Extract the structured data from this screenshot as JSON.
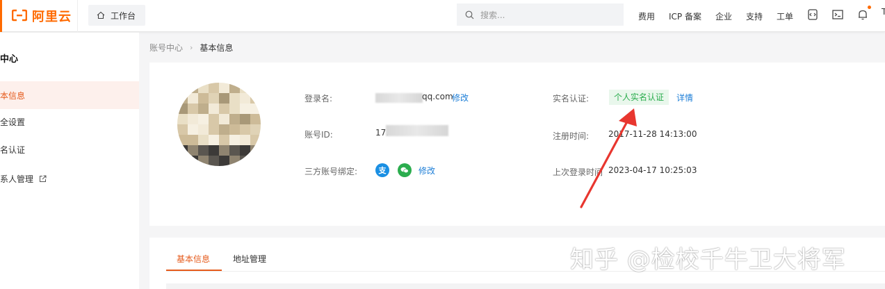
{
  "topbar": {
    "logo_text": "阿里云",
    "workbench_label": "工作台",
    "search_placeholder": "搜索...",
    "nav": [
      "费用",
      "ICP 备案",
      "企业",
      "支持",
      "工单"
    ],
    "truncated_char": "T"
  },
  "sidebar": {
    "title": "中心",
    "items": [
      {
        "label": "本信息",
        "active": true
      },
      {
        "label": "全设置",
        "active": false
      },
      {
        "label": "名认证",
        "active": false
      },
      {
        "label": "系人管理",
        "active": false
      }
    ]
  },
  "breadcrumb": {
    "parent": "账号中心",
    "separator": "›",
    "current": "基本信息"
  },
  "profile": {
    "login_label": "登录名:",
    "login_value_suffix": "qq.com",
    "login_edit": "修改",
    "account_id_label": "账号ID:",
    "account_id_prefix": "17.",
    "third_party_label": "三方账号绑定:",
    "third_party_edit": "修改",
    "realname_label": "实名认证:",
    "realname_badge": "个人实名认证",
    "realname_detail": "详情",
    "register_label": "注册时间:",
    "register_value": "2017-11-28 14:13:00",
    "last_login_label": "上次登录时间",
    "last_login_value": "2023-04-17 10:25:03"
  },
  "tabs": [
    {
      "label": "基本信息",
      "active": true
    },
    {
      "label": "地址管理",
      "active": false
    }
  ],
  "watermark": "知乎 @检校千牛卫大将军",
  "colors": {
    "brand": "#ff6a00",
    "link": "#1d7ed7",
    "success": "#2bad4e",
    "arrow": "#e8362f"
  }
}
